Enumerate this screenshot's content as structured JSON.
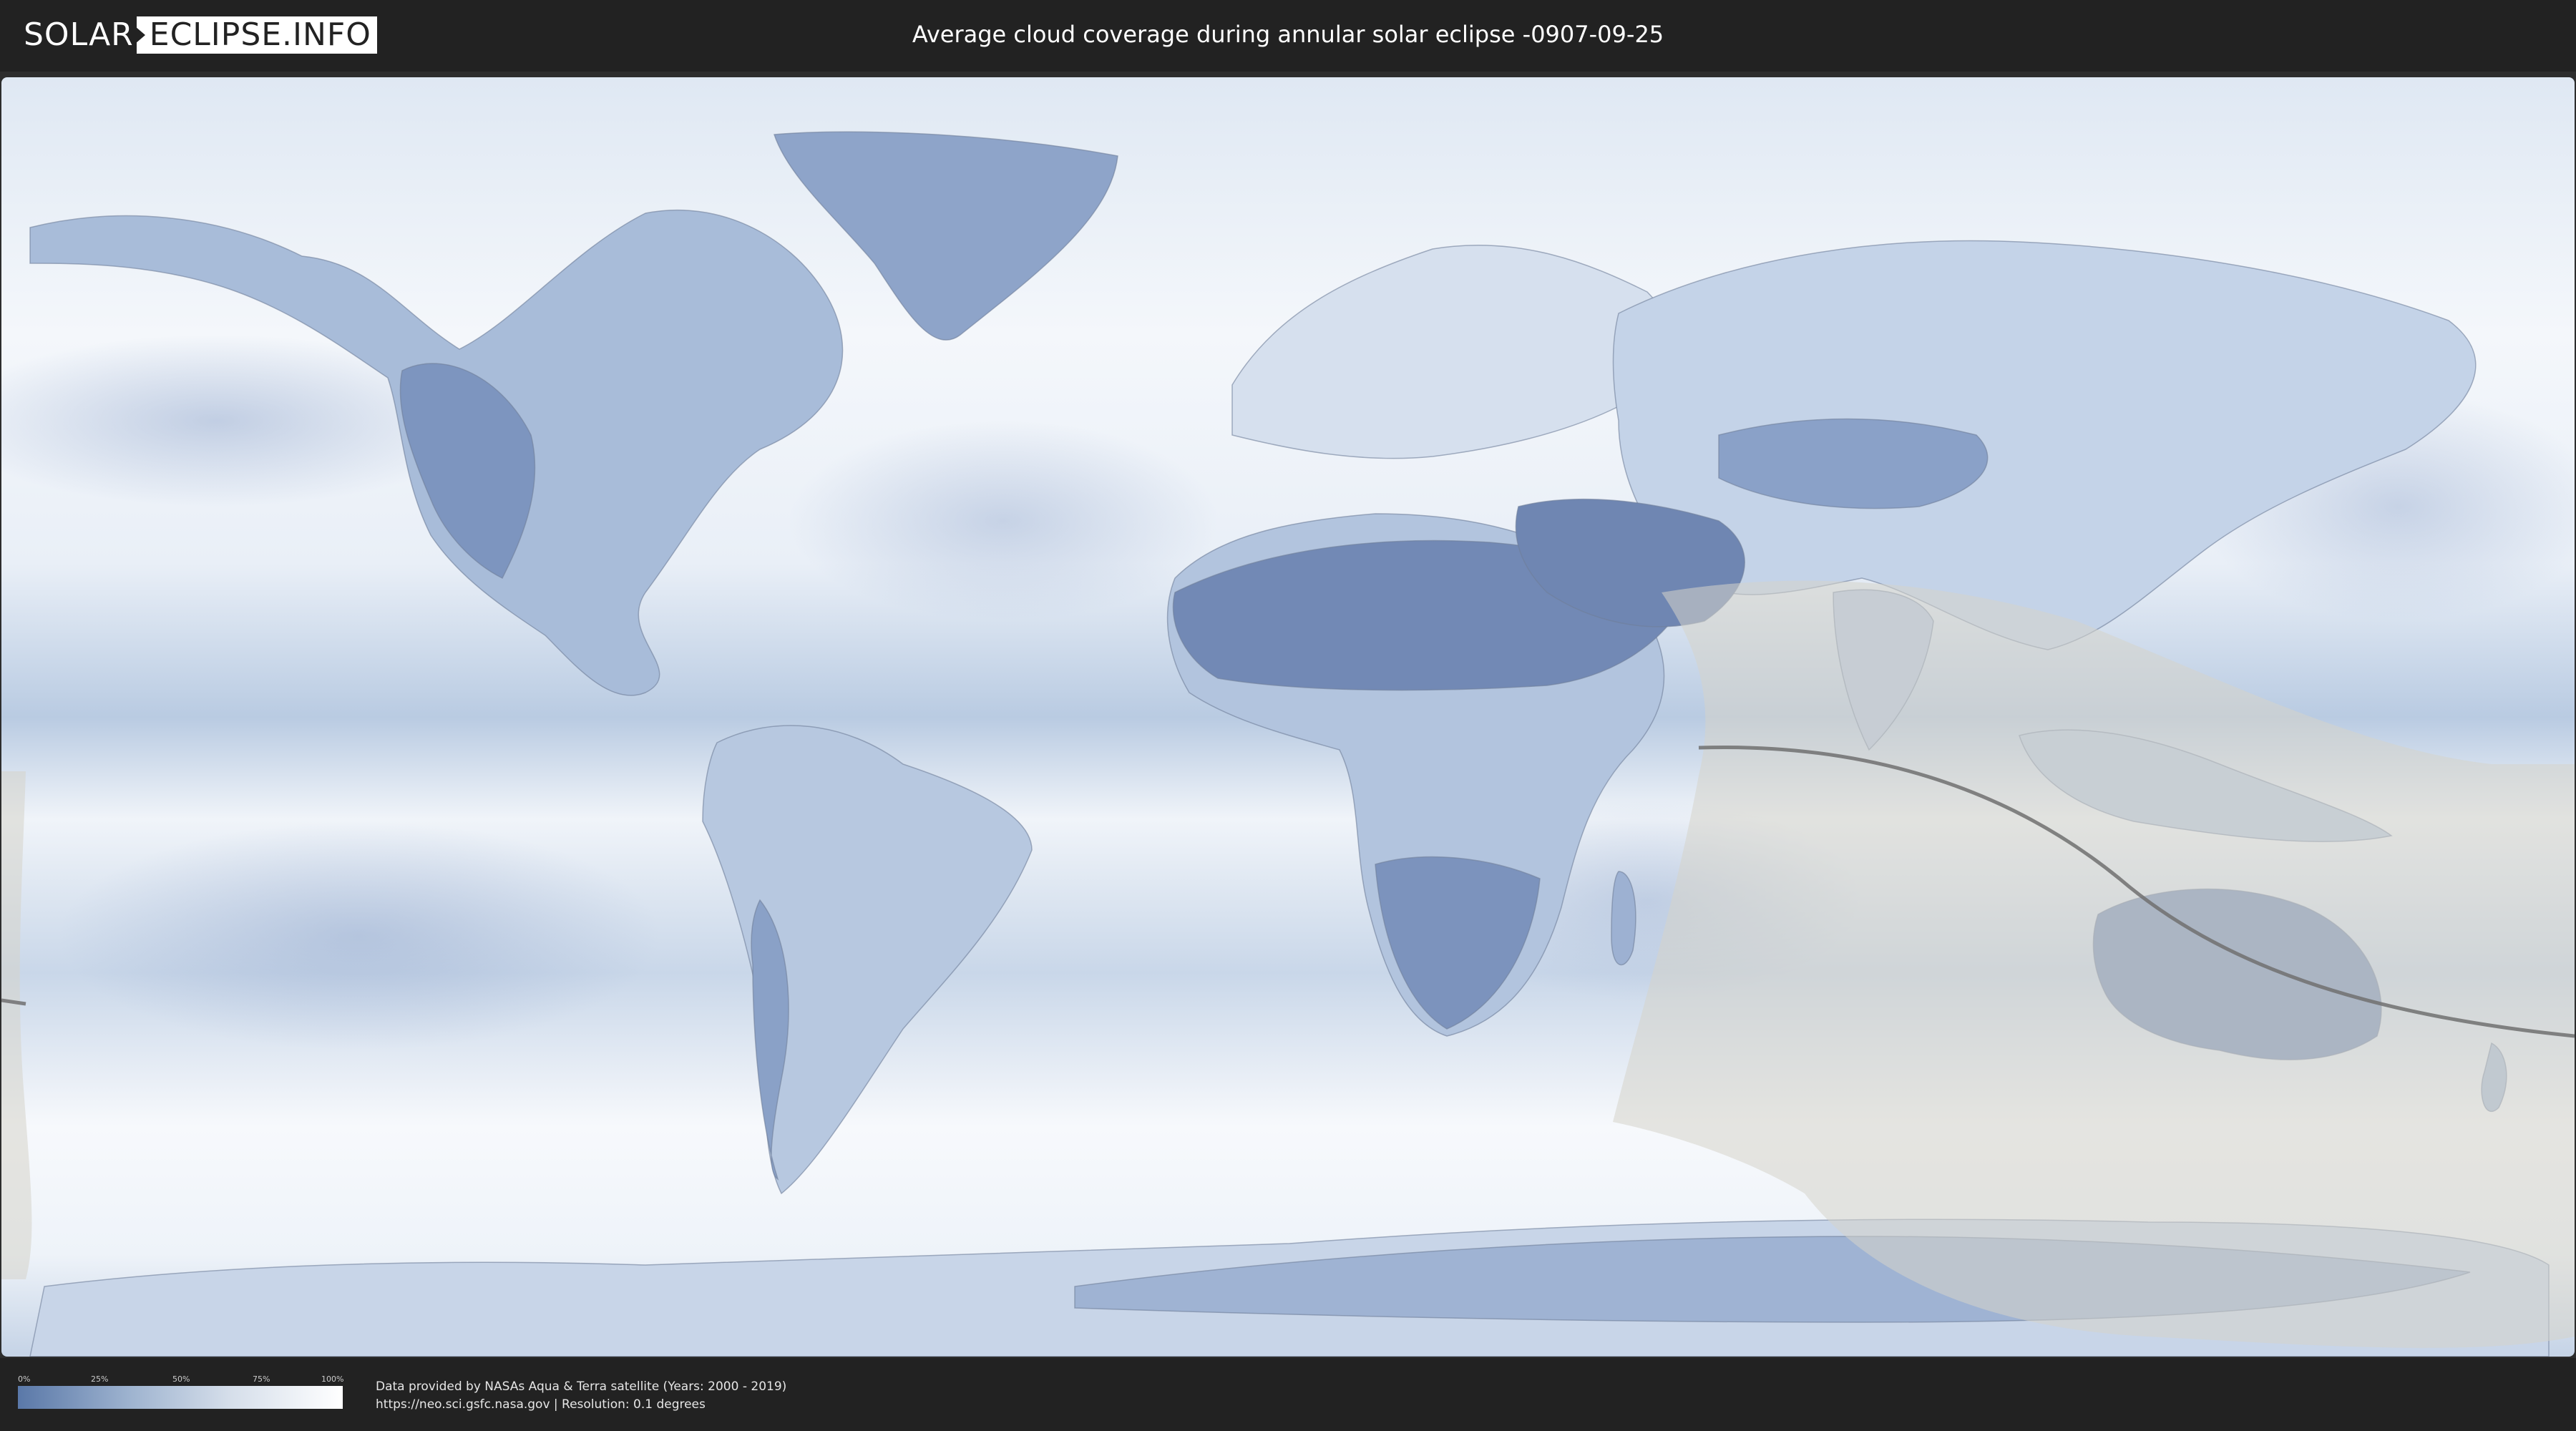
{
  "header": {
    "logo_left": "SOLAR",
    "logo_right": "ECLIPSE.INFO",
    "title": "Average cloud coverage during annular solar eclipse -0907-09-25"
  },
  "legend": {
    "labels": [
      "0%",
      "25%",
      "50%",
      "75%",
      "100%"
    ],
    "colors": [
      "#5a78a8",
      "#9fb4d0",
      "#d5deea",
      "#ffffff"
    ]
  },
  "footer": {
    "credit_line1": "Data provided by NASAs Aqua & Terra satellite (Years: 2000 - 2019)",
    "credit_line2": "https://neo.sci.gsfc.nasa.gov | Resolution: 0.1 degrees"
  },
  "map": {
    "ocean_color": "#e4ecf5",
    "cloud_color": "#ffffff",
    "land_clear_color": "#7d95bf",
    "eclipse_zone_color": "#d9d6cf",
    "central_line_color": "#707070"
  }
}
